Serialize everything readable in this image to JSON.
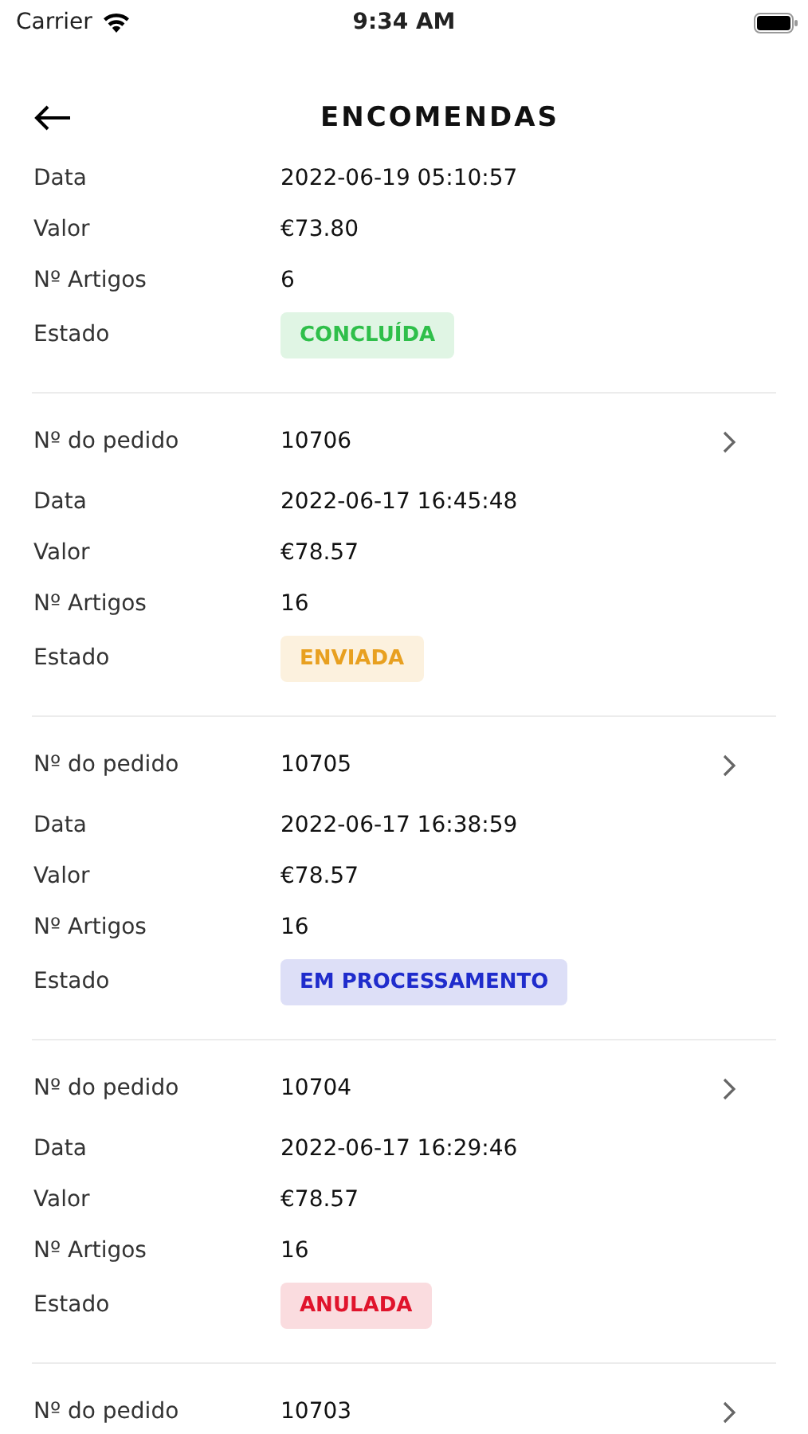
{
  "status_bar": {
    "carrier": "Carrier",
    "time": "9:34 AM"
  },
  "header": {
    "title": "ENCOMENDAS"
  },
  "orders": [
    {
      "rows": [
        {
          "kind": "detail",
          "label": "Data",
          "value": "2022-06-19 05:10:57"
        },
        {
          "kind": "detail",
          "label": "Valor",
          "value": "€73.80"
        },
        {
          "kind": "detail",
          "label": "Nº Artigos",
          "value": "6"
        },
        {
          "kind": "status",
          "label": "Estado",
          "value": "CONCLUÍDA",
          "color": "#2fbf4a"
        }
      ]
    },
    {
      "rows": [
        {
          "kind": "number",
          "label": "Nº do pedido",
          "value": "10706"
        },
        {
          "kind": "detail",
          "label": "Data",
          "value": "2022-06-17 16:45:48"
        },
        {
          "kind": "detail",
          "label": "Valor",
          "value": "€78.57"
        },
        {
          "kind": "detail",
          "label": "Nº Artigos",
          "value": "16"
        },
        {
          "kind": "status",
          "label": "Estado",
          "value": "ENVIADA",
          "color": "#e8a020"
        }
      ]
    },
    {
      "rows": [
        {
          "kind": "number",
          "label": "Nº do pedido",
          "value": "10705"
        },
        {
          "kind": "detail",
          "label": "Data",
          "value": "2022-06-17 16:38:59"
        },
        {
          "kind": "detail",
          "label": "Valor",
          "value": "€78.57"
        },
        {
          "kind": "detail",
          "label": "Nº Artigos",
          "value": "16"
        },
        {
          "kind": "status",
          "label": "Estado",
          "value": "EM PROCESSAMENTO",
          "color": "#1f2ccc"
        }
      ]
    },
    {
      "rows": [
        {
          "kind": "number",
          "label": "Nº do pedido",
          "value": "10704"
        },
        {
          "kind": "detail",
          "label": "Data",
          "value": "2022-06-17 16:29:46"
        },
        {
          "kind": "detail",
          "label": "Valor",
          "value": "€78.57"
        },
        {
          "kind": "detail",
          "label": "Nº Artigos",
          "value": "16"
        },
        {
          "kind": "status",
          "label": "Estado",
          "value": "ANULADA",
          "color": "#e0142c"
        }
      ]
    },
    {
      "rows": [
        {
          "kind": "number",
          "label": "Nº do pedido",
          "value": "10703"
        }
      ]
    }
  ]
}
